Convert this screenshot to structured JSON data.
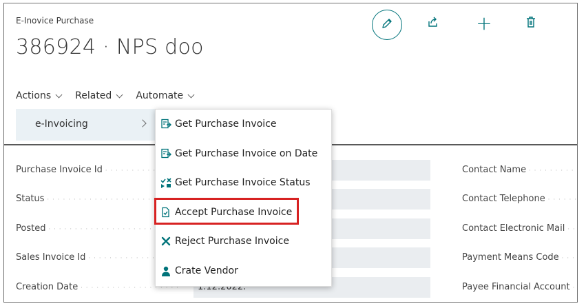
{
  "header": {
    "caption": "E-Inovice Purchase",
    "title": "386924 · NPS doo"
  },
  "actionbar": {
    "items": [
      {
        "label": "Actions"
      },
      {
        "label": "Related"
      },
      {
        "label": "Automate"
      }
    ]
  },
  "submenu": {
    "label": "e-Invoicing"
  },
  "menu": {
    "items": [
      {
        "label": "Get Purchase Invoice",
        "icon": "get-invoice-icon"
      },
      {
        "label": "Get Purchase Invoice on Date",
        "icon": "get-invoice-icon"
      },
      {
        "label": "Get Purchase Invoice Status",
        "icon": "status-icon"
      },
      {
        "label": "Accept Purchase Invoice",
        "icon": "accept-document-icon"
      },
      {
        "label": "Reject Purchase Invoice",
        "icon": "reject-icon"
      },
      {
        "label": "Crate Vendor",
        "icon": "person-icon"
      }
    ]
  },
  "fields": {
    "left": [
      {
        "label": "Purchase Invoice Id",
        "value": ""
      },
      {
        "label": "Status",
        "value": ""
      },
      {
        "label": "Posted",
        "value": ""
      },
      {
        "label": "Sales Invoice Id",
        "value": ""
      },
      {
        "label": "Creation Date",
        "value": "1.12.2022."
      }
    ],
    "right": [
      {
        "label": "Contact Name"
      },
      {
        "label": "Contact Telephone"
      },
      {
        "label": "Contact Electronic Mail"
      },
      {
        "label": "Payment Means Code"
      },
      {
        "label": "Payee Financial Account"
      }
    ]
  },
  "colors": {
    "accent": "#00737a",
    "highlight": "#d72222",
    "menu_bg": "#eaf1f5"
  }
}
